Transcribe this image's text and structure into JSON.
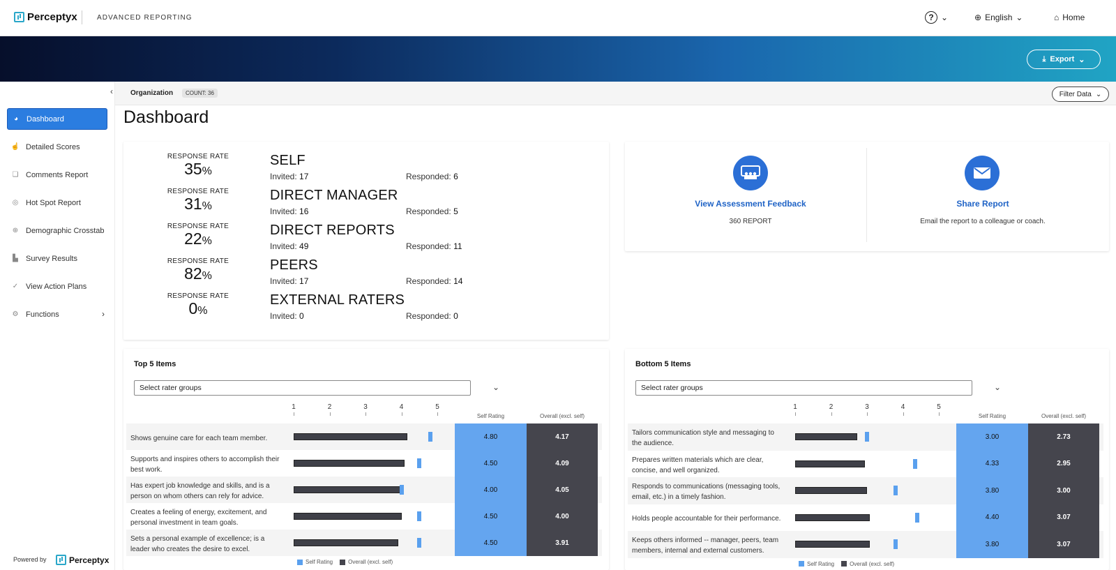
{
  "header": {
    "brand": "Perceptyx",
    "app_title": "ADVANCED REPORTING",
    "help_label": "?",
    "language": "English",
    "home": "Home"
  },
  "banner": {
    "export_label": "Export"
  },
  "sidebar": {
    "items": [
      {
        "label": "Dashboard",
        "icon": "dashboard-icon"
      },
      {
        "label": "Detailed Scores",
        "icon": "thumbs-up-icon"
      },
      {
        "label": "Comments Report",
        "icon": "comments-icon"
      },
      {
        "label": "Hot Spot Report",
        "icon": "target-icon"
      },
      {
        "label": "Demographic Crosstab",
        "icon": "globe-icon"
      },
      {
        "label": "Survey Results",
        "icon": "bar-chart-icon"
      },
      {
        "label": "View Action Plans",
        "icon": "check-circle-icon"
      },
      {
        "label": "Functions",
        "icon": "gear-icon"
      }
    ],
    "powered_by": "Powered by",
    "powered_brand": "Perceptyx"
  },
  "filterbar": {
    "org": "Organization",
    "count": "COUNT: 36",
    "filter_label": "Filter Data"
  },
  "page_title": "Dashboard",
  "response": {
    "rate_label": "RESPONSE RATE",
    "invited_label": "Invited:",
    "responded_label": "Responded:",
    "groups": [
      {
        "rate": "35",
        "name": "SELF",
        "invited": "17",
        "responded": "6"
      },
      {
        "rate": "31",
        "name": "DIRECT MANAGER",
        "invited": "16",
        "responded": "5"
      },
      {
        "rate": "22",
        "name": "DIRECT REPORTS",
        "invited": "49",
        "responded": "11"
      },
      {
        "rate": "82",
        "name": "PEERS",
        "invited": "17",
        "responded": "14"
      },
      {
        "rate": "0",
        "name": "EXTERNAL RATERS",
        "invited": "0",
        "responded": "0"
      }
    ]
  },
  "actions": [
    {
      "title": "View Assessment Feedback",
      "sub": "360 REPORT",
      "icon": "presentation-icon"
    },
    {
      "title": "Share Report",
      "sub": "Email the report to a colleague or coach.",
      "icon": "envelope-icon"
    }
  ],
  "top5": {
    "title": "Top 5 Items",
    "select_placeholder": "Select rater groups",
    "col_self": "Self Rating",
    "col_overall": "Overall (excl. self)",
    "legend_self": "Self Rating",
    "legend_overall": "Overall (excl. self)",
    "axis": [
      "1",
      "2",
      "3",
      "4",
      "5"
    ],
    "rows": [
      {
        "text": "Shows genuine care for each team member.",
        "self": "4.80",
        "overall": "4.17"
      },
      {
        "text": "Supports and inspires others to accomplish their best work.",
        "self": "4.50",
        "overall": "4.09"
      },
      {
        "text": "Has expert job knowledge and skills, and is a person on whom others can rely for advice.",
        "self": "4.00",
        "overall": "4.05"
      },
      {
        "text": "Creates a feeling of energy, excitement, and personal investment in team goals.",
        "self": "4.50",
        "overall": "4.00"
      },
      {
        "text": "Sets a personal example of excellence; is a leader who creates the desire to excel.",
        "self": "4.50",
        "overall": "3.91"
      }
    ]
  },
  "bottom5": {
    "title": "Bottom 5 Items",
    "select_placeholder": "Select rater groups",
    "col_self": "Self Rating",
    "col_overall": "Overall (excl. self)",
    "legend_self": "Self Rating",
    "legend_overall": "Overall (excl. self)",
    "axis": [
      "1",
      "2",
      "3",
      "4",
      "5"
    ],
    "rows": [
      {
        "text": "Tailors communication style and messaging to the audience.",
        "self": "3.00",
        "overall": "2.73"
      },
      {
        "text": "Prepares written materials which are clear, concise, and well organized.",
        "self": "4.33",
        "overall": "2.95"
      },
      {
        "text": "Responds to communications (messaging tools, email, etc.) in a timely fashion.",
        "self": "3.80",
        "overall": "3.00"
      },
      {
        "text": "Holds people accountable for their performance.",
        "self": "4.40",
        "overall": "3.07"
      },
      {
        "text": "Keeps others informed -- manager, peers, team members, internal and external customers.",
        "self": "3.80",
        "overall": "3.07"
      }
    ]
  },
  "colors": {
    "accent": "#2b7de0",
    "self": "#64a5ef",
    "overall": "#45454d"
  }
}
